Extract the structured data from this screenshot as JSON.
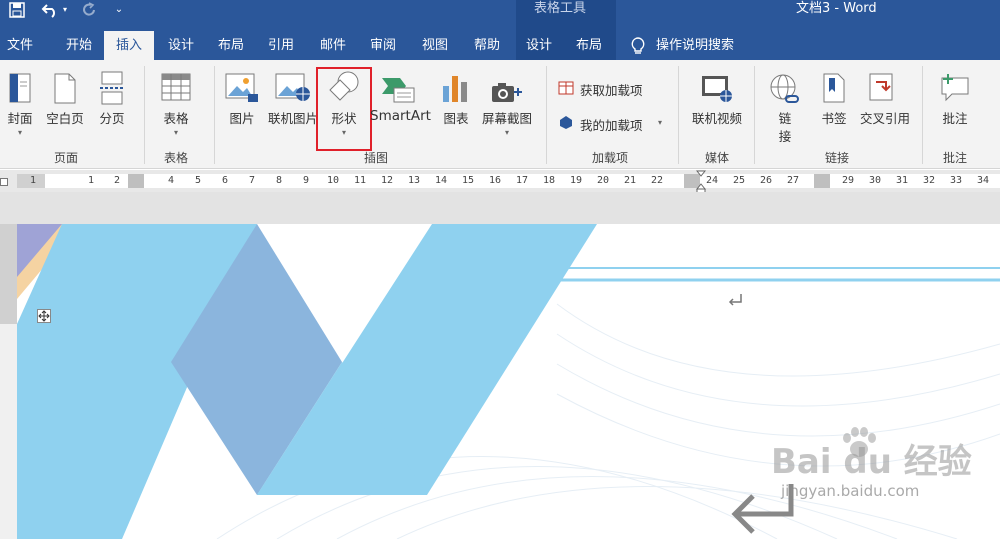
{
  "window": {
    "doc_title": "文档3  -  Word",
    "context_group": "表格工具"
  },
  "quick_access": {
    "save_icon": "save-icon",
    "undo_icon": "undo-icon",
    "redo_icon": "redo-icon",
    "customize_icon": "customize-icon"
  },
  "tabs": [
    "文件",
    "开始",
    "插入",
    "设计",
    "布局",
    "引用",
    "邮件",
    "审阅",
    "视图",
    "帮助",
    "设计",
    "布局"
  ],
  "tell_me": "操作说明搜索",
  "ribbon": {
    "pages": {
      "cover": "封面",
      "blank": "空白页",
      "break": "分页",
      "group": "页面"
    },
    "tables": {
      "table": "表格",
      "group": "表格"
    },
    "illustrations": {
      "picture": "图片",
      "online_picture": "联机图片",
      "shapes": "形状",
      "smartart": "SmartArt",
      "chart": "图表",
      "screenshot": "屏幕截图",
      "group": "插图"
    },
    "addins": {
      "get": "获取加载项",
      "my": "我的加载项",
      "group": "加载项"
    },
    "media": {
      "online_video": "联机视频",
      "group": "媒体"
    },
    "links": {
      "link_line1": "链",
      "link_line2": "接",
      "bookmark": "书签",
      "cross_ref": "交叉引用",
      "group": "链接"
    },
    "comments": {
      "comment": "批注",
      "group": "批注"
    }
  },
  "ruler": {
    "ticks": [
      "1",
      "1",
      "2",
      "4",
      "5",
      "6",
      "7",
      "8",
      "9",
      "10",
      "11",
      "12",
      "13",
      "14",
      "15",
      "16",
      "17",
      "18",
      "19",
      "20",
      "21",
      "22",
      "24",
      "25",
      "26",
      "27",
      "29",
      "30",
      "31",
      "32",
      "33",
      "34"
    ]
  },
  "colors": {
    "word_blue": "#2b579a",
    "highlight": "#e0202a",
    "light_blue": "#8fd1ef",
    "steel_blue": "#8bb5dd"
  },
  "watermark": {
    "brand": "Bai du 经验",
    "url": "jingyan.baidu.com"
  }
}
